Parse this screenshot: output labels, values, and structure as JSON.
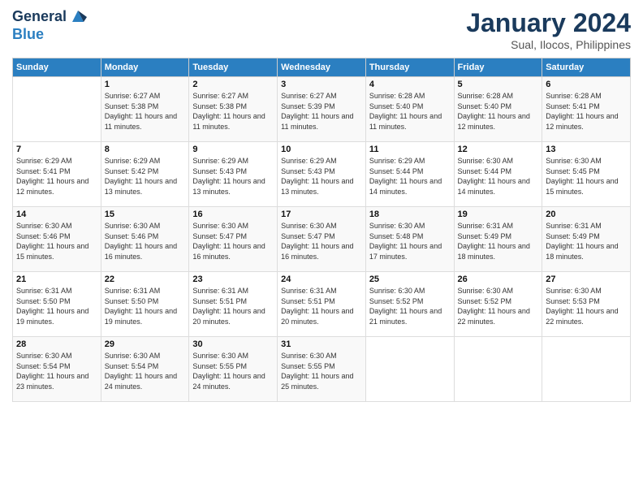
{
  "header": {
    "logo_line1": "General",
    "logo_line2": "Blue",
    "title": "January 2024",
    "subtitle": "Sual, Ilocos, Philippines"
  },
  "weekdays": [
    "Sunday",
    "Monday",
    "Tuesday",
    "Wednesday",
    "Thursday",
    "Friday",
    "Saturday"
  ],
  "weeks": [
    [
      {
        "day": "",
        "sunrise": "",
        "sunset": "",
        "daylight": ""
      },
      {
        "day": "1",
        "sunrise": "Sunrise: 6:27 AM",
        "sunset": "Sunset: 5:38 PM",
        "daylight": "Daylight: 11 hours and 11 minutes."
      },
      {
        "day": "2",
        "sunrise": "Sunrise: 6:27 AM",
        "sunset": "Sunset: 5:38 PM",
        "daylight": "Daylight: 11 hours and 11 minutes."
      },
      {
        "day": "3",
        "sunrise": "Sunrise: 6:27 AM",
        "sunset": "Sunset: 5:39 PM",
        "daylight": "Daylight: 11 hours and 11 minutes."
      },
      {
        "day": "4",
        "sunrise": "Sunrise: 6:28 AM",
        "sunset": "Sunset: 5:40 PM",
        "daylight": "Daylight: 11 hours and 11 minutes."
      },
      {
        "day": "5",
        "sunrise": "Sunrise: 6:28 AM",
        "sunset": "Sunset: 5:40 PM",
        "daylight": "Daylight: 11 hours and 12 minutes."
      },
      {
        "day": "6",
        "sunrise": "Sunrise: 6:28 AM",
        "sunset": "Sunset: 5:41 PM",
        "daylight": "Daylight: 11 hours and 12 minutes."
      }
    ],
    [
      {
        "day": "7",
        "sunrise": "Sunrise: 6:29 AM",
        "sunset": "Sunset: 5:41 PM",
        "daylight": "Daylight: 11 hours and 12 minutes."
      },
      {
        "day": "8",
        "sunrise": "Sunrise: 6:29 AM",
        "sunset": "Sunset: 5:42 PM",
        "daylight": "Daylight: 11 hours and 13 minutes."
      },
      {
        "day": "9",
        "sunrise": "Sunrise: 6:29 AM",
        "sunset": "Sunset: 5:43 PM",
        "daylight": "Daylight: 11 hours and 13 minutes."
      },
      {
        "day": "10",
        "sunrise": "Sunrise: 6:29 AM",
        "sunset": "Sunset: 5:43 PM",
        "daylight": "Daylight: 11 hours and 13 minutes."
      },
      {
        "day": "11",
        "sunrise": "Sunrise: 6:29 AM",
        "sunset": "Sunset: 5:44 PM",
        "daylight": "Daylight: 11 hours and 14 minutes."
      },
      {
        "day": "12",
        "sunrise": "Sunrise: 6:30 AM",
        "sunset": "Sunset: 5:44 PM",
        "daylight": "Daylight: 11 hours and 14 minutes."
      },
      {
        "day": "13",
        "sunrise": "Sunrise: 6:30 AM",
        "sunset": "Sunset: 5:45 PM",
        "daylight": "Daylight: 11 hours and 15 minutes."
      }
    ],
    [
      {
        "day": "14",
        "sunrise": "Sunrise: 6:30 AM",
        "sunset": "Sunset: 5:46 PM",
        "daylight": "Daylight: 11 hours and 15 minutes."
      },
      {
        "day": "15",
        "sunrise": "Sunrise: 6:30 AM",
        "sunset": "Sunset: 5:46 PM",
        "daylight": "Daylight: 11 hours and 16 minutes."
      },
      {
        "day": "16",
        "sunrise": "Sunrise: 6:30 AM",
        "sunset": "Sunset: 5:47 PM",
        "daylight": "Daylight: 11 hours and 16 minutes."
      },
      {
        "day": "17",
        "sunrise": "Sunrise: 6:30 AM",
        "sunset": "Sunset: 5:47 PM",
        "daylight": "Daylight: 11 hours and 16 minutes."
      },
      {
        "day": "18",
        "sunrise": "Sunrise: 6:30 AM",
        "sunset": "Sunset: 5:48 PM",
        "daylight": "Daylight: 11 hours and 17 minutes."
      },
      {
        "day": "19",
        "sunrise": "Sunrise: 6:31 AM",
        "sunset": "Sunset: 5:49 PM",
        "daylight": "Daylight: 11 hours and 18 minutes."
      },
      {
        "day": "20",
        "sunrise": "Sunrise: 6:31 AM",
        "sunset": "Sunset: 5:49 PM",
        "daylight": "Daylight: 11 hours and 18 minutes."
      }
    ],
    [
      {
        "day": "21",
        "sunrise": "Sunrise: 6:31 AM",
        "sunset": "Sunset: 5:50 PM",
        "daylight": "Daylight: 11 hours and 19 minutes."
      },
      {
        "day": "22",
        "sunrise": "Sunrise: 6:31 AM",
        "sunset": "Sunset: 5:50 PM",
        "daylight": "Daylight: 11 hours and 19 minutes."
      },
      {
        "day": "23",
        "sunrise": "Sunrise: 6:31 AM",
        "sunset": "Sunset: 5:51 PM",
        "daylight": "Daylight: 11 hours and 20 minutes."
      },
      {
        "day": "24",
        "sunrise": "Sunrise: 6:31 AM",
        "sunset": "Sunset: 5:51 PM",
        "daylight": "Daylight: 11 hours and 20 minutes."
      },
      {
        "day": "25",
        "sunrise": "Sunrise: 6:30 AM",
        "sunset": "Sunset: 5:52 PM",
        "daylight": "Daylight: 11 hours and 21 minutes."
      },
      {
        "day": "26",
        "sunrise": "Sunrise: 6:30 AM",
        "sunset": "Sunset: 5:52 PM",
        "daylight": "Daylight: 11 hours and 22 minutes."
      },
      {
        "day": "27",
        "sunrise": "Sunrise: 6:30 AM",
        "sunset": "Sunset: 5:53 PM",
        "daylight": "Daylight: 11 hours and 22 minutes."
      }
    ],
    [
      {
        "day": "28",
        "sunrise": "Sunrise: 6:30 AM",
        "sunset": "Sunset: 5:54 PM",
        "daylight": "Daylight: 11 hours and 23 minutes."
      },
      {
        "day": "29",
        "sunrise": "Sunrise: 6:30 AM",
        "sunset": "Sunset: 5:54 PM",
        "daylight": "Daylight: 11 hours and 24 minutes."
      },
      {
        "day": "30",
        "sunrise": "Sunrise: 6:30 AM",
        "sunset": "Sunset: 5:55 PM",
        "daylight": "Daylight: 11 hours and 24 minutes."
      },
      {
        "day": "31",
        "sunrise": "Sunrise: 6:30 AM",
        "sunset": "Sunset: 5:55 PM",
        "daylight": "Daylight: 11 hours and 25 minutes."
      },
      {
        "day": "",
        "sunrise": "",
        "sunset": "",
        "daylight": ""
      },
      {
        "day": "",
        "sunrise": "",
        "sunset": "",
        "daylight": ""
      },
      {
        "day": "",
        "sunrise": "",
        "sunset": "",
        "daylight": ""
      }
    ]
  ]
}
